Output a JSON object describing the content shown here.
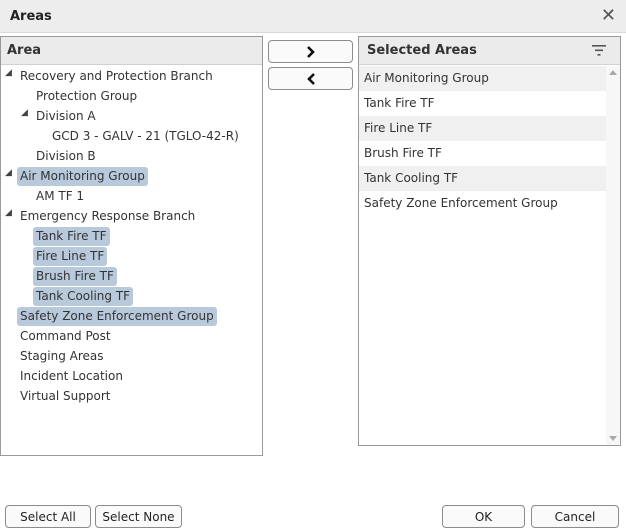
{
  "dialog": {
    "title": "Areas"
  },
  "area_panel": {
    "header": "Area",
    "items": [
      {
        "label": "Recovery and Protection Branch",
        "level": 0,
        "expandable": true,
        "selected": false
      },
      {
        "label": "Protection Group",
        "level": 1,
        "expandable": false,
        "selected": false
      },
      {
        "label": "Division A",
        "level": 1,
        "expandable": true,
        "selected": false
      },
      {
        "label": "GCD 3 - GALV - 21 (TGLO-42-R)",
        "level": 2,
        "expandable": false,
        "selected": false
      },
      {
        "label": "Division B",
        "level": 1,
        "expandable": false,
        "selected": false
      },
      {
        "label": "Air Monitoring Group",
        "level": 0,
        "expandable": true,
        "selected": true
      },
      {
        "label": "AM TF 1",
        "level": 1,
        "expandable": false,
        "selected": false
      },
      {
        "label": "Emergency Response Branch",
        "level": 0,
        "expandable": true,
        "selected": false
      },
      {
        "label": "Tank Fire TF",
        "level": 1,
        "expandable": false,
        "selected": true
      },
      {
        "label": "Fire Line TF",
        "level": 1,
        "expandable": false,
        "selected": true
      },
      {
        "label": "Brush Fire TF",
        "level": 1,
        "expandable": false,
        "selected": true
      },
      {
        "label": "Tank Cooling TF",
        "level": 1,
        "expandable": false,
        "selected": true
      },
      {
        "label": "Safety Zone Enforcement Group",
        "level": 0,
        "expandable": false,
        "selected": true
      },
      {
        "label": "Command Post",
        "level": 0,
        "expandable": false,
        "selected": false
      },
      {
        "label": "Staging Areas",
        "level": 0,
        "expandable": false,
        "selected": false
      },
      {
        "label": "Incident Location",
        "level": 0,
        "expandable": false,
        "selected": false
      },
      {
        "label": "Virtual Support",
        "level": 0,
        "expandable": false,
        "selected": false
      }
    ]
  },
  "selected_panel": {
    "header": "Selected Areas",
    "items": [
      "Air Monitoring Group",
      "Tank Fire TF",
      "Fire Line TF",
      "Brush Fire TF",
      "Tank Cooling TF",
      "Safety Zone Enforcement Group"
    ]
  },
  "icons": {
    "close": "close-icon",
    "move_right": "chevron-right-icon",
    "move_left": "chevron-left-icon",
    "filter": "filter-icon",
    "expand": "expanded-triangle-icon"
  },
  "buttons": {
    "select_all": "Select All",
    "select_none": "Select None",
    "ok": "OK",
    "cancel": "Cancel"
  },
  "colors": {
    "selection": "#b9c9dc",
    "header_bg": "#ebebeb",
    "alt_row": "#f0f0f0"
  }
}
